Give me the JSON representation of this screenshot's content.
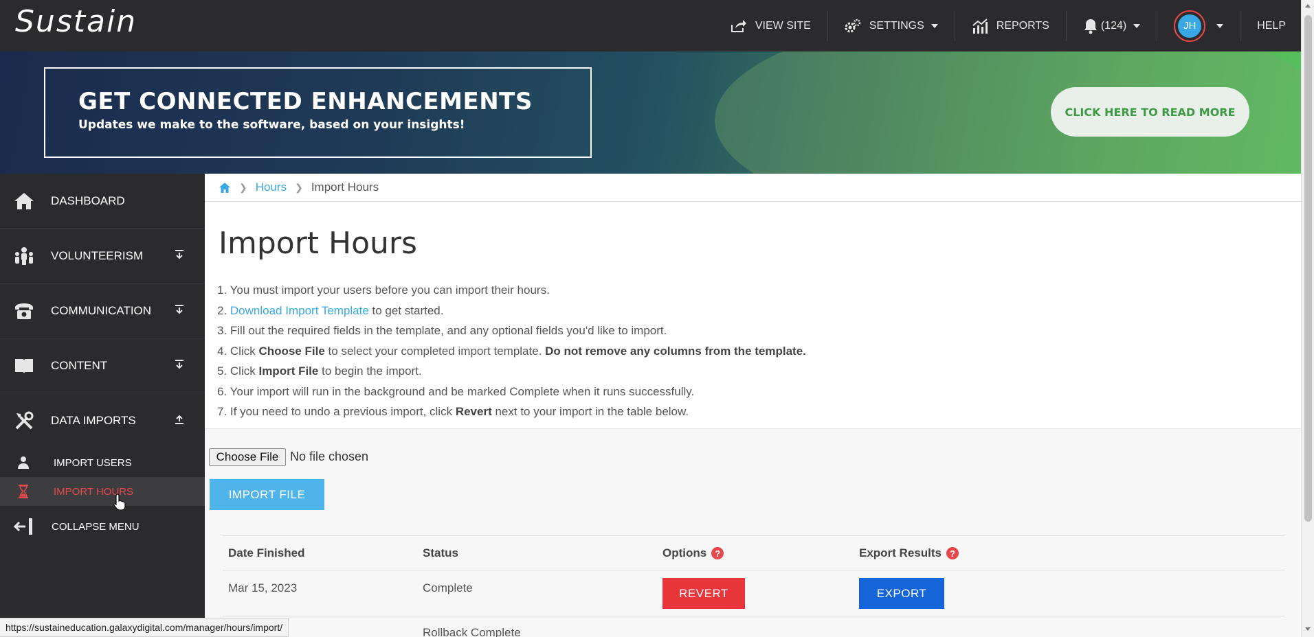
{
  "app": {
    "brand": "Sustain"
  },
  "topnav": {
    "view_site": "VIEW SITE",
    "settings": "SETTINGS",
    "reports": "REPORTS",
    "notifications": "(124)",
    "avatar_initials": "JH",
    "help": "HELP"
  },
  "banner": {
    "title": "GET CONNECTED ENHANCEMENTS",
    "subtitle": "Updates we make to the software, based on your insights!",
    "cta": "CLICK HERE TO READ MORE"
  },
  "sidebar": {
    "items": [
      {
        "label": "DASHBOARD",
        "icon": "home-icon"
      },
      {
        "label": "VOLUNTEERISM",
        "icon": "people-icon"
      },
      {
        "label": "COMMUNICATION",
        "icon": "phone-icon"
      },
      {
        "label": "CONTENT",
        "icon": "book-icon"
      },
      {
        "label": "DATA IMPORTS",
        "icon": "tools-icon"
      }
    ],
    "sub_items": [
      {
        "label": "IMPORT USERS",
        "icon": "user-icon"
      },
      {
        "label": "IMPORT HOURS",
        "icon": "hourglass-icon",
        "active": true
      }
    ],
    "collapse": "COLLAPSE MENU"
  },
  "breadcrumb": {
    "parent": "Hours",
    "current": "Import Hours"
  },
  "page": {
    "title": "Import Hours",
    "steps": {
      "s1": "1. You must import your users before you can import their hours.",
      "s2_prefix": "2. ",
      "s2_link": "Download Import Template",
      "s2_suffix": " to get started.",
      "s3": "3. Fill out the required fields in the template, and any optional fields you'd like to import.",
      "s4_prefix": "4. Click ",
      "s4_bold": "Choose File",
      "s4_mid": " to select your completed import template. ",
      "s4_bold2": "Do not remove any columns from the template.",
      "s5_prefix": "5. Click ",
      "s5_bold": "Import File",
      "s5_suffix": " to begin the import.",
      "s6": "6. Your import will run in the background and be marked Complete when it runs successfully.",
      "s7_prefix": "7. If you need to undo a previous import, click ",
      "s7_bold": "Revert",
      "s7_suffix": " next to your import in the table below."
    },
    "choose_file": "Choose File",
    "no_file": "No file chosen",
    "import_button": "IMPORT FILE"
  },
  "table": {
    "headers": {
      "date": "Date Finished",
      "status": "Status",
      "options": "Options",
      "export": "Export Results"
    },
    "help_glyph": "?",
    "rows": [
      {
        "date": "Mar 15, 2023",
        "status": "Complete",
        "revert": "REVERT",
        "export": "EXPORT"
      },
      {
        "date": "",
        "status": "Rollback Complete"
      }
    ]
  },
  "status_url": "https://sustaineducation.galaxydigital.com/manager/hours/import/",
  "colors": {
    "accent_blue": "#3aa8e4",
    "danger": "#e8353a",
    "export_blue": "#1565d8",
    "active_red": "#e8484b"
  }
}
